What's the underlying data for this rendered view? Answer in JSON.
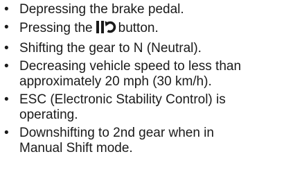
{
  "bullet_char": "•",
  "items": [
    {
      "text": "Depressing the brake pedal."
    },
    {
      "before": "Pressing the",
      "icon": "pause-resume-icon",
      "after": "button."
    },
    {
      "text": "Shifting the gear to N (Neutral)."
    },
    {
      "line1": "Decreasing vehicle speed to less than",
      "line2": "approximately 20 mph (30 km/h)."
    },
    {
      "line1": "ESC (Electronic Stability Control) is",
      "line2": "operating."
    },
    {
      "line1": "Downshifting to 2nd gear when in",
      "line2": "Manual Shift mode."
    }
  ]
}
